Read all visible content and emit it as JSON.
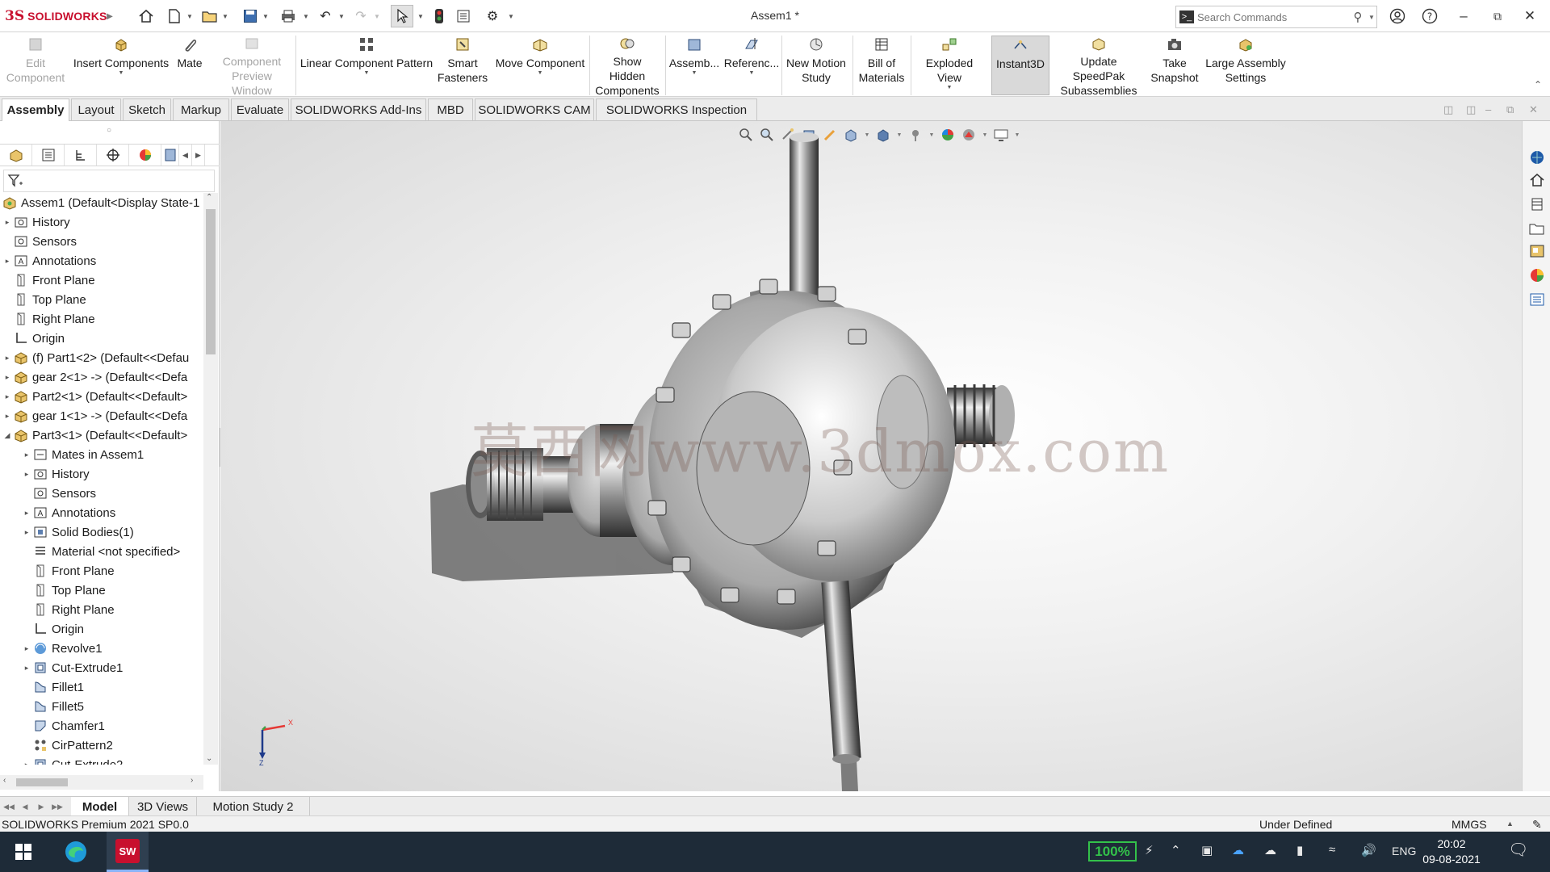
{
  "app": {
    "brand": "SOLIDWORKS",
    "brand_prefix": "3S",
    "document_title": "Assem1 *"
  },
  "search": {
    "placeholder": "Search Commands"
  },
  "ribbon": {
    "buttons": [
      {
        "label": "Edit Component",
        "enabled": false
      },
      {
        "label": "Insert Components",
        "enabled": true
      },
      {
        "label": "Mate",
        "enabled": true
      },
      {
        "label": "Component Preview Window",
        "enabled": false
      },
      {
        "label": "Linear Component Pattern",
        "enabled": true
      },
      {
        "label": "Smart Fasteners",
        "enabled": true
      },
      {
        "label": "Move Component",
        "enabled": true
      },
      {
        "label": "Show Hidden Components",
        "enabled": true
      },
      {
        "label": "Assemb...",
        "enabled": true
      },
      {
        "label": "Referenc...",
        "enabled": true
      },
      {
        "label": "New Motion Study",
        "enabled": true
      },
      {
        "label": "Bill of Materials",
        "enabled": true
      },
      {
        "label": "Exploded View",
        "enabled": true
      },
      {
        "label": "Instant3D",
        "enabled": true,
        "active": true
      },
      {
        "label": "Update SpeedPak Subassemblies",
        "enabled": true
      },
      {
        "label": "Take Snapshot",
        "enabled": true
      },
      {
        "label": "Large Assembly Settings",
        "enabled": true
      }
    ]
  },
  "command_tabs": [
    "Assembly",
    "Layout",
    "Sketch",
    "Markup",
    "Evaluate",
    "SOLIDWORKS Add-Ins",
    "MBD",
    "SOLIDWORKS CAM",
    "SOLIDWORKS Inspection"
  ],
  "tree": {
    "root": "Assem1  (Default<Display State-1",
    "items": [
      {
        "label": "History",
        "icon": "history-folder-icon",
        "level": 1,
        "expandable": true
      },
      {
        "label": "Sensors",
        "icon": "sensors-icon",
        "level": 1,
        "expandable": false
      },
      {
        "label": "Annotations",
        "icon": "annotations-icon",
        "level": 1,
        "expandable": true
      },
      {
        "label": "Front Plane",
        "icon": "plane-icon",
        "level": 1,
        "expandable": false
      },
      {
        "label": "Top Plane",
        "icon": "plane-icon",
        "level": 1,
        "expandable": false
      },
      {
        "label": "Right Plane",
        "icon": "plane-icon",
        "level": 1,
        "expandable": false
      },
      {
        "label": "Origin",
        "icon": "origin-icon",
        "level": 1,
        "expandable": false
      },
      {
        "label": "(f) Part1<2> (Default<<Defau",
        "icon": "part-icon",
        "level": 1,
        "expandable": true
      },
      {
        "label": "gear 2<1> -> (Default<<Defa",
        "icon": "part-icon",
        "level": 1,
        "expandable": true
      },
      {
        "label": "Part2<1> (Default<<Default>",
        "icon": "part-icon",
        "level": 1,
        "expandable": true
      },
      {
        "label": "gear 1<1> -> (Default<<Defa",
        "icon": "part-icon",
        "level": 1,
        "expandable": true
      },
      {
        "label": "Part3<1> (Default<<Default>",
        "icon": "part-icon",
        "level": 1,
        "expandable": true,
        "expanded": true
      },
      {
        "label": "Mates in Assem1",
        "icon": "mates-icon",
        "level": 2,
        "expandable": true
      },
      {
        "label": "History",
        "icon": "history-folder-icon",
        "level": 2,
        "expandable": true
      },
      {
        "label": "Sensors",
        "icon": "sensors-icon",
        "level": 2,
        "expandable": false
      },
      {
        "label": "Annotations",
        "icon": "annotations-icon",
        "level": 2,
        "expandable": true
      },
      {
        "label": "Solid Bodies(1)",
        "icon": "solid-bodies-icon",
        "level": 2,
        "expandable": true
      },
      {
        "label": "Material <not specified>",
        "icon": "material-icon",
        "level": 2,
        "expandable": false
      },
      {
        "label": "Front Plane",
        "icon": "plane-icon",
        "level": 2,
        "expandable": false
      },
      {
        "label": "Top Plane",
        "icon": "plane-icon",
        "level": 2,
        "expandable": false
      },
      {
        "label": "Right Plane",
        "icon": "plane-icon",
        "level": 2,
        "expandable": false
      },
      {
        "label": "Origin",
        "icon": "origin-icon",
        "level": 2,
        "expandable": false
      },
      {
        "label": "Revolve1",
        "icon": "revolve-icon",
        "level": 2,
        "expandable": true
      },
      {
        "label": "Cut-Extrude1",
        "icon": "cut-extrude-icon",
        "level": 2,
        "expandable": true
      },
      {
        "label": "Fillet1",
        "icon": "fillet-icon",
        "level": 2,
        "expandable": false
      },
      {
        "label": "Fillet5",
        "icon": "fillet-icon",
        "level": 2,
        "expandable": false
      },
      {
        "label": "Chamfer1",
        "icon": "chamfer-icon",
        "level": 2,
        "expandable": false
      },
      {
        "label": "CirPattern2",
        "icon": "circular-pattern-icon",
        "level": 2,
        "expandable": false
      },
      {
        "label": "Cut-Extrude2",
        "icon": "cut-extrude-icon",
        "level": 2,
        "expandable": true
      }
    ]
  },
  "graphics": {
    "watermark": "莫西网www.3dmox.com",
    "triad": {
      "x_label": "X",
      "z_label": "Z"
    }
  },
  "bottom_tabs": [
    "Model",
    "3D Views",
    "Motion Study 2"
  ],
  "status": {
    "product": "SOLIDWORKS Premium 2021 SP0.0",
    "state": "Under Defined",
    "units": "MMGS"
  },
  "taskbar": {
    "battery_percent": "100%",
    "language": "ENG",
    "time": "20:02",
    "date": "09-08-2021"
  },
  "colors": {
    "brand_red": "#c8102e",
    "taskbar": "#1e2b38",
    "battery_green": "#33c24a"
  }
}
